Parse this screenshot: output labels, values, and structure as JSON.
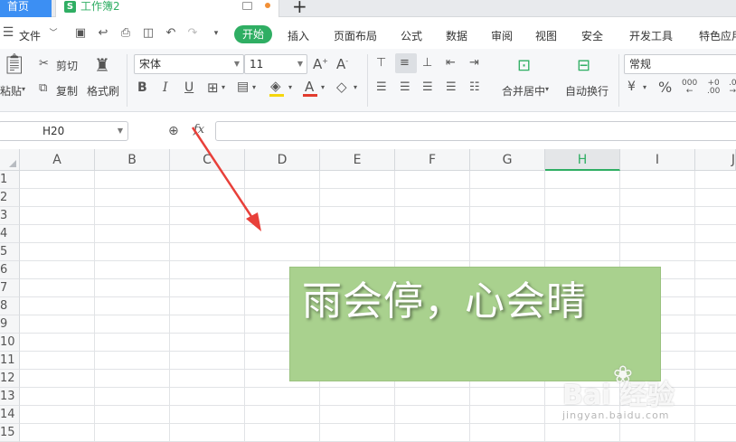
{
  "tabs": {
    "home": "首页",
    "workbook": "工作簿2",
    "new_tab": "+"
  },
  "menu": {
    "file": "文件",
    "start": "开始",
    "items": [
      "插入",
      "页面布局",
      "公式",
      "数据",
      "审阅",
      "视图",
      "安全",
      "开发工具",
      "特色应用"
    ]
  },
  "ribbon": {
    "paste": "粘贴",
    "cut": "剪切",
    "copy": "复制",
    "format_painter": "格式刷",
    "font_name": "宋体",
    "font_size": "11",
    "merge_center": "合并居中",
    "auto_wrap": "自动换行",
    "number_format": "常规",
    "percent": "%",
    "bold": "B",
    "italic": "I",
    "underline": "U",
    "font_color_letter": "A"
  },
  "formula_bar": {
    "name_box": "H20",
    "fx": "fx",
    "formula": ""
  },
  "grid": {
    "columns": [
      "A",
      "B",
      "C",
      "D",
      "E",
      "F",
      "G",
      "H",
      "I",
      "J"
    ],
    "active_column": "H",
    "rows": [
      "1",
      "2",
      "3",
      "4",
      "5",
      "6",
      "7",
      "8",
      "9",
      "10",
      "11",
      "12",
      "13",
      "14",
      "15"
    ]
  },
  "textbox": {
    "text": "雨会停，心会晴",
    "fill_color": "#a9d18e"
  },
  "annotation": {
    "arrow_color": "#e8403a"
  },
  "watermark": {
    "brand": "Bai 经验",
    "url": "jingyan.baidu.com"
  },
  "colors": {
    "accent": "#2fae63",
    "home_tab": "#3c8ff3"
  }
}
